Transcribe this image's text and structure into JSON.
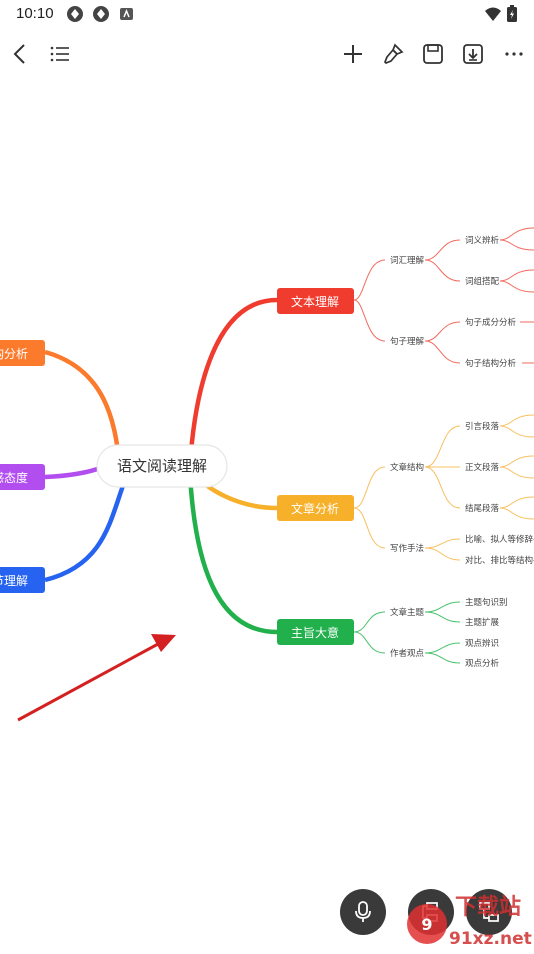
{
  "status_bar": {
    "time": "10:10"
  },
  "mindmap": {
    "root": "语文阅读理解",
    "left_branches": [
      {
        "label": "结构分析",
        "color": "#fb7a2c"
      },
      {
        "label": "情感态度",
        "color": "#b24df0"
      },
      {
        "label": "细节理解",
        "color": "#2563f0"
      }
    ],
    "right_branches": [
      {
        "label": "文本理解",
        "color": "#f03c2e",
        "children": [
          {
            "label": "词汇理解",
            "children": [
              "词义辨析",
              "词组搭配"
            ]
          },
          {
            "label": "句子理解",
            "children": [
              "句子成分分析",
              "句子结构分析"
            ]
          }
        ]
      },
      {
        "label": "文章分析",
        "color": "#f7b02a",
        "children": [
          {
            "label": "文章结构",
            "children": [
              "引言段落",
              "正文段落",
              "结尾段落"
            ]
          },
          {
            "label": "写作手法",
            "children": [
              "比喻、拟人等修辞手",
              "对比、排比等结构手"
            ]
          }
        ]
      },
      {
        "label": "主旨大意",
        "color": "#21b04c",
        "children": [
          {
            "label": "文章主题",
            "children": [
              "主题句识别",
              "主题扩展"
            ]
          },
          {
            "label": "作者观点",
            "children": [
              "观点辨识",
              "观点分析"
            ]
          }
        ]
      }
    ]
  },
  "watermark": {
    "brand": "下载站",
    "domain": "91xz.net"
  },
  "colors": {
    "arrow": "#d42020",
    "fab": "#3a3a3a"
  }
}
